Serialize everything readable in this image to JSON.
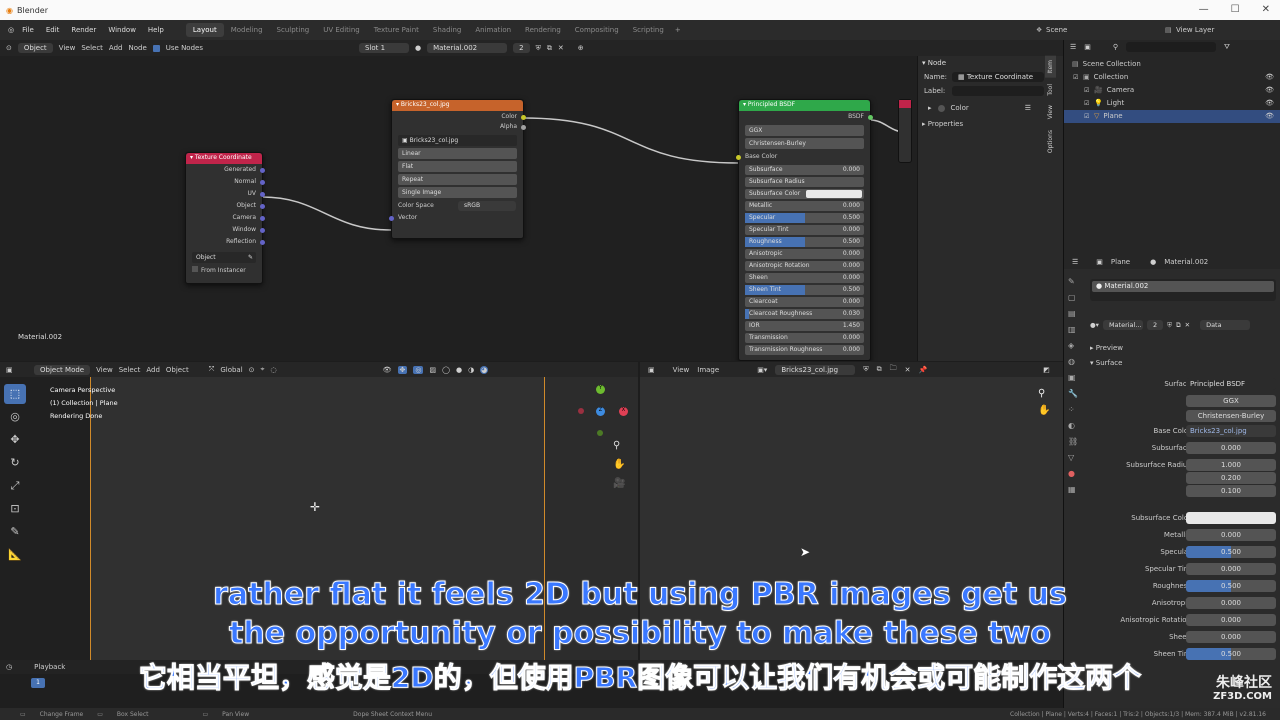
{
  "titlebar": {
    "title": "Blender"
  },
  "menu": [
    "File",
    "Edit",
    "Render",
    "Window",
    "Help"
  ],
  "workspaces": [
    "Layout",
    "Modeling",
    "Sculpting",
    "UV Editing",
    "Texture Paint",
    "Shading",
    "Animation",
    "Rendering",
    "Compositing",
    "Scripting"
  ],
  "scene": {
    "label": "Scene",
    "view_layer": "View Layer"
  },
  "node_header": {
    "mode": "Object",
    "view": "View",
    "select": "Select",
    "add": "Add",
    "node": "Node",
    "use_nodes": "Use Nodes",
    "slot": "Slot 1",
    "material": "Material.002",
    "users": "2"
  },
  "node_editor": {
    "material_label": "Material.002",
    "texcoord": {
      "title": "Texture Coordinate",
      "outputs": [
        "Generated",
        "Normal",
        "UV",
        "Object",
        "Camera",
        "Window",
        "Reflection"
      ],
      "object_label": "Object",
      "from_instancer": "From Instancer"
    },
    "image": {
      "title": "Bricks23_col.jpg",
      "outputs": [
        "Color",
        "Alpha"
      ],
      "file": "Bricks23_col.jpg",
      "interpolation": "Linear",
      "projection": "Flat",
      "extension": "Repeat",
      "source": "Single Image",
      "colorspace_label": "Color Space",
      "colorspace": "sRGB",
      "vector": "Vector"
    },
    "bsdf": {
      "title": "Principled BSDF",
      "output": "BSDF",
      "distribution": "GGX",
      "subsurface_method": "Christensen-Burley",
      "base_color": "Base Color",
      "inputs": [
        {
          "name": "Subsurface",
          "value": "0.000",
          "fill": 0
        },
        {
          "name": "Subsurface Radius",
          "value": "",
          "fill": 0
        },
        {
          "name": "Subsurface Color",
          "value": "",
          "fill": 0
        },
        {
          "name": "Metallic",
          "value": "0.000",
          "fill": 0
        },
        {
          "name": "Specular",
          "value": "0.500",
          "fill": 0.5
        },
        {
          "name": "Specular Tint",
          "value": "0.000",
          "fill": 0
        },
        {
          "name": "Roughness",
          "value": "0.500",
          "fill": 0.5
        },
        {
          "name": "Anisotropic",
          "value": "0.000",
          "fill": 0
        },
        {
          "name": "Anisotropic Rotation",
          "value": "0.000",
          "fill": 0
        },
        {
          "name": "Sheen",
          "value": "0.000",
          "fill": 0
        },
        {
          "name": "Sheen Tint",
          "value": "0.500",
          "fill": 0.5
        },
        {
          "name": "Clearcoat",
          "value": "0.000",
          "fill": 0
        },
        {
          "name": "Clearcoat Roughness",
          "value": "0.030",
          "fill": 0.03
        },
        {
          "name": "IOR",
          "value": "1.450",
          "fill": 0
        },
        {
          "name": "Transmission",
          "value": "0.000",
          "fill": 0
        },
        {
          "name": "Transmission Roughness",
          "value": "0.000",
          "fill": 0
        }
      ]
    }
  },
  "npanel": {
    "section": "Node",
    "name_label": "Name:",
    "name_value": "Texture Coordinate",
    "label_label": "Label:",
    "color": "Color",
    "properties": "Properties",
    "tabs": [
      "Item",
      "Tool",
      "View",
      "Options"
    ]
  },
  "outliner": {
    "items": [
      {
        "name": "Scene Collection",
        "indent": 0
      },
      {
        "name": "Collection",
        "indent": 1
      },
      {
        "name": "Camera",
        "indent": 2
      },
      {
        "name": "Light",
        "indent": 2
      },
      {
        "name": "Plane",
        "indent": 2
      }
    ]
  },
  "props": {
    "object": "Plane",
    "material": "Material.002",
    "slot": "Material.002",
    "mat_field": "Material...",
    "users": "2",
    "data": "Data",
    "preview": "Preview",
    "surface": "Surface",
    "rows": [
      {
        "label": "Surface",
        "value": "Principled BSDF",
        "fill": 0
      },
      {
        "label": "",
        "value": "GGX",
        "fill": 0
      },
      {
        "label": "",
        "value": "Christensen-Burley",
        "fill": 0
      },
      {
        "label": "Base Color",
        "value": "Bricks23_col.jpg",
        "fill": 0
      },
      {
        "label": "Subsurface",
        "value": "0.000",
        "fill": 0
      },
      {
        "label": "Subsurface Radius",
        "value": "1.000",
        "fill": 0
      },
      {
        "label": "",
        "value": "0.200",
        "fill": 0
      },
      {
        "label": "",
        "value": "0.100",
        "fill": 0
      },
      {
        "label": "Subsurface Color",
        "value": "",
        "fill": 0
      },
      {
        "label": "Metallic",
        "value": "0.000",
        "fill": 0
      },
      {
        "label": "Specular",
        "value": "0.500",
        "fill": 0.5
      },
      {
        "label": "Specular Tint",
        "value": "0.000",
        "fill": 0
      },
      {
        "label": "Roughness",
        "value": "0.500",
        "fill": 0.5
      },
      {
        "label": "Anisotropic",
        "value": "0.000",
        "fill": 0
      },
      {
        "label": "Anisotropic Rotation",
        "value": "0.000",
        "fill": 0
      },
      {
        "label": "Sheen",
        "value": "0.000",
        "fill": 0
      },
      {
        "label": "Sheen Tint",
        "value": "0.500",
        "fill": 0.5
      }
    ]
  },
  "viewport": {
    "mode": "Object Mode",
    "view": "View",
    "select": "Select",
    "add": "Add",
    "object": "Object",
    "orientation": "Global",
    "info1": "Camera Perspective",
    "info2": "(1) Collection | Plane",
    "info3": "Rendering Done"
  },
  "image_editor": {
    "view": "View",
    "image": "Image",
    "file": "Bricks23_col.jpg"
  },
  "timeline": {
    "playback": "Playback",
    "frame": "1"
  },
  "status": {
    "change_frame": "Change Frame",
    "box_select": "Box Select",
    "pan_view": "Pan View",
    "context": "Dope Sheet Context Menu",
    "stats": "Collection | Plane | Verts:4 | Faces:1 | Tris:2 | Objects:1/3 | Mem: 387.4 MiB | v2.81.16"
  },
  "subtitles": {
    "line1": "rather flat it feels 2D but using PBR images get us",
    "line2": "the opportunity or possibility to make these two",
    "line3": "它相当平坦，感觉是2D的，但使用PBR图像可以让我们有机会或可能制作这两个"
  },
  "watermark": {
    "cn": "朱峰社区",
    "en": "ZF3D.COM"
  },
  "colors": {
    "accent": "#4772b3",
    "texcoord_header": "#c0244a",
    "image_header": "#c6632b",
    "bsdf_header": "#2fa84a",
    "subtitle": "#3a78ff"
  }
}
